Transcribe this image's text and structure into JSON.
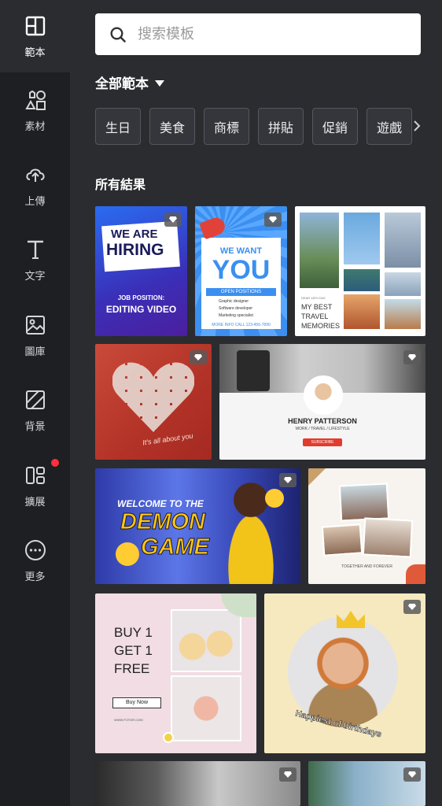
{
  "sidebar": {
    "items": [
      {
        "label": "範本",
        "icon": "template-icon"
      },
      {
        "label": "素材",
        "icon": "elements-icon"
      },
      {
        "label": "上傳",
        "icon": "upload-icon"
      },
      {
        "label": "文字",
        "icon": "text-icon"
      },
      {
        "label": "圖庫",
        "icon": "gallery-icon"
      },
      {
        "label": "背景",
        "icon": "background-icon"
      },
      {
        "label": "擴展",
        "icon": "extensions-icon"
      },
      {
        "label": "更多",
        "icon": "more-icon"
      }
    ]
  },
  "search": {
    "placeholder": "搜索模板"
  },
  "filter": {
    "label": "全部範本"
  },
  "chips": [
    "生日",
    "美食",
    "商標",
    "拼貼",
    "促銷",
    "遊戲"
  ],
  "section": {
    "title": "所有結果"
  },
  "templates": {
    "hiring": {
      "line1": "WE ARE",
      "line2": "HIRING",
      "sub1": "JOB POSITION:",
      "sub2": "EDITING VIDEO"
    },
    "want": {
      "line1": "WE WANT",
      "line2": "YOU",
      "bar": "OPEN POSITIONS",
      "items": [
        "Graphic designer",
        "Software developer",
        "Marketing specialist"
      ],
      "footer": "MORE INFO CALL 123-456-7890"
    },
    "travel": {
      "small": "DEAR 18TH DAY",
      "line1": "MY BEST",
      "line2": "TRAVEL",
      "line3": "MEMORIES"
    },
    "collage": {
      "caption": "It's all about you"
    },
    "henry": {
      "name": "HENRY PATTERSON",
      "sub": "WORK / TRAVEL / LIFESTYLE",
      "button": "SUBSCRIBE"
    },
    "demon": {
      "line1": "WELCOME TO THE",
      "line2": "DEMON",
      "line3": "GAME"
    },
    "family": {
      "caption": "TOGETHER AND FOREVER"
    },
    "cupcake": {
      "line1": "BUY 1",
      "line2": "GET 1",
      "line3": "FREE",
      "button": "Buy Now",
      "site": "WWW.FOTOR.COM"
    },
    "birthday": {
      "caption": "Happiest of birthdays"
    }
  },
  "colors": {
    "accent_red": "#ff2f3d",
    "sidebar_bg": "#1e1f22",
    "content_bg": "#2b2c30"
  }
}
